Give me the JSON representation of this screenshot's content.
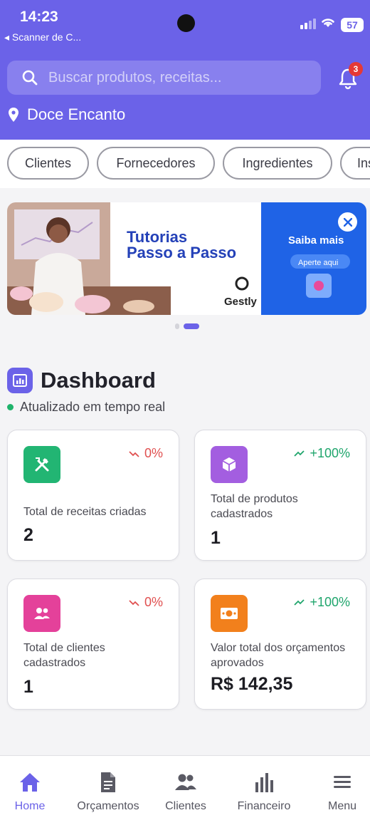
{
  "status_bar": {
    "time": "14:23",
    "back_app": "◂ Scanner de C...",
    "battery": "57"
  },
  "header": {
    "search_placeholder": "Buscar produtos, receitas...",
    "notification_count": "3",
    "store_name": "Doce Encanto"
  },
  "chips": [
    "Clientes",
    "Fornecedores",
    "Ingredientes",
    "Ins"
  ],
  "banner": {
    "title_line1": "Tutorias",
    "title_line2": "Passo a Passo",
    "brand": "Gestly",
    "side_title": "Saiba mais",
    "side_button": "Aperte aqui"
  },
  "dashboard": {
    "title": "Dashboard",
    "subtitle": "Atualizado em tempo real",
    "cards": [
      {
        "label": "Total de receitas criadas",
        "value": "2",
        "trend": "0%",
        "trend_dir": "down",
        "icon": "utensils-icon"
      },
      {
        "label": "Total de produtos cadastrados",
        "value": "1",
        "trend": "+100%",
        "trend_dir": "up",
        "icon": "cube-icon"
      },
      {
        "label": "Total de clientes cadastrados",
        "value": "1",
        "trend": "0%",
        "trend_dir": "down",
        "icon": "users-icon"
      },
      {
        "label": "Valor total dos orçamentos aprovados",
        "value": "R$ 142,35",
        "trend": "+100%",
        "trend_dir": "up",
        "icon": "money-icon"
      }
    ]
  },
  "nav": {
    "items": [
      {
        "label": "Home",
        "icon": "home-icon",
        "active": true
      },
      {
        "label": "Orçamentos",
        "icon": "document-icon"
      },
      {
        "label": "Clientes",
        "icon": "users-icon"
      },
      {
        "label": "Financeiro",
        "icon": "bar-chart-icon"
      },
      {
        "label": "Menu",
        "icon": "hamburger-icon"
      }
    ]
  },
  "colors": {
    "primary": "#6b62e8",
    "green": "#22b573",
    "purple": "#a35ee0",
    "pink": "#e4419a",
    "orange": "#f2801c",
    "trend_up": "#1fa56c",
    "trend_down": "#e05050"
  }
}
